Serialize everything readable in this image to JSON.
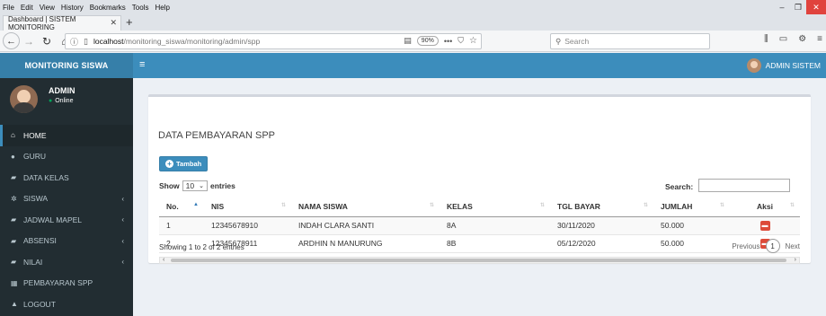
{
  "browser": {
    "menu": [
      "File",
      "Edit",
      "View",
      "History",
      "Bookmarks",
      "Tools",
      "Help"
    ],
    "tab_title": "Dashboard | SISTEM MONITORING",
    "url_host": "localhost",
    "url_path": "/monitoring_siswa/monitoring/admin/spp",
    "zoom": "90%",
    "search_placeholder": "Search"
  },
  "header": {
    "logo": "MONITORING SISWA",
    "user": "ADMIN SISTEM"
  },
  "sidebar": {
    "user_name": "ADMIN",
    "user_status": "Online",
    "items": [
      {
        "label": "HOME",
        "icon": "home-icon",
        "active": true,
        "sub": false
      },
      {
        "label": "GURU",
        "icon": "user-icon",
        "active": false,
        "sub": false
      },
      {
        "label": "DATA KELAS",
        "icon": "folder-icon",
        "active": false,
        "sub": false
      },
      {
        "label": "SISWA",
        "icon": "users-icon",
        "active": false,
        "sub": true
      },
      {
        "label": "JADWAL MAPEL",
        "icon": "folder-icon",
        "active": false,
        "sub": true
      },
      {
        "label": "ABSENSI",
        "icon": "folder-icon",
        "active": false,
        "sub": true
      },
      {
        "label": "NILAI",
        "icon": "folder-icon",
        "active": false,
        "sub": true
      },
      {
        "label": "PEMBAYARAN SPP",
        "icon": "table-icon",
        "active": false,
        "sub": false
      },
      {
        "label": "LOGOUT",
        "icon": "lock-icon",
        "active": false,
        "sub": false
      }
    ]
  },
  "content": {
    "title": "DATA PEMBAYARAN SPP",
    "add_button": "Tambah",
    "show_label": "Show",
    "entries_value": "10",
    "entries_label": "entries",
    "search_label": "Search:",
    "columns": [
      "No.",
      "NIS",
      "NAMA SISWA",
      "KELAS",
      "TGL BAYAR",
      "JUMLAH",
      "Aksi"
    ],
    "rows": [
      {
        "no": "1",
        "nis": "12345678910",
        "nama": "INDAH CLARA SANTI",
        "kelas": "8A",
        "tgl": "30/11/2020",
        "jumlah": "50.000"
      },
      {
        "no": "2",
        "nis": "12345678911",
        "nama": "ARDHIN N MANURUNG",
        "kelas": "8B",
        "tgl": "05/12/2020",
        "jumlah": "50.000"
      }
    ],
    "info": "Showing 1 to 2 of 2 entries",
    "prev": "Previous",
    "page": "1",
    "next": "Next"
  },
  "colors": {
    "header": "#3c8dbc",
    "logo_bg": "#367fa9",
    "sidebar": "#222d32",
    "delete": "#dd4b39"
  }
}
